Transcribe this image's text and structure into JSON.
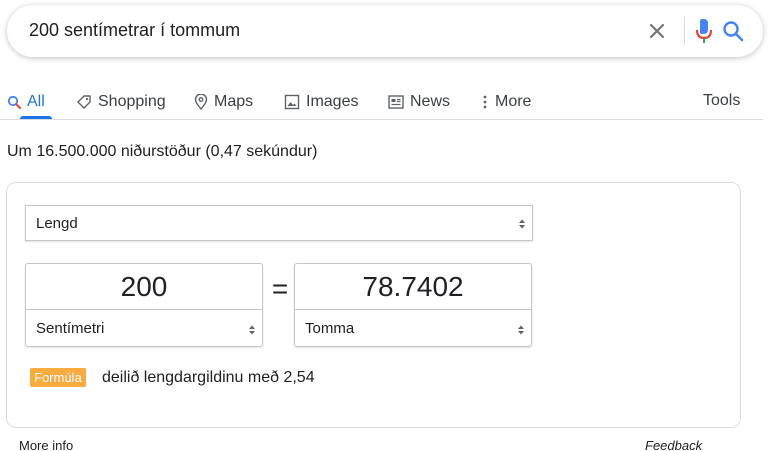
{
  "search": {
    "query": "200 sentímetrar í tommum"
  },
  "tabs": [
    {
      "label": "All",
      "icon": "search-icon",
      "active": true
    },
    {
      "label": "Shopping",
      "icon": "tag-icon"
    },
    {
      "label": "Maps",
      "icon": "map-pin-icon"
    },
    {
      "label": "Images",
      "icon": "image-icon"
    },
    {
      "label": "News",
      "icon": "news-icon"
    },
    {
      "label": "More",
      "icon": "more-vert-icon"
    }
  ],
  "tools_label": "Tools",
  "result_stats": "Um 16.500.000 niðurstöður (0,47 sekúndur)",
  "converter": {
    "unit_type": "Lengd",
    "from_value": "200",
    "from_unit": "Sentímetri",
    "equals": "=",
    "to_value": "78.7402",
    "to_unit": "Tomma",
    "formula_label": "Formúla",
    "formula_text": "deilið lengdargildinu með 2,54"
  },
  "footer": {
    "more_info": "More info",
    "feedback": "Feedback"
  },
  "colors": {
    "accent": "#1a73e8",
    "formula_badge": "#f9ab3e",
    "border": "#dadce0"
  }
}
